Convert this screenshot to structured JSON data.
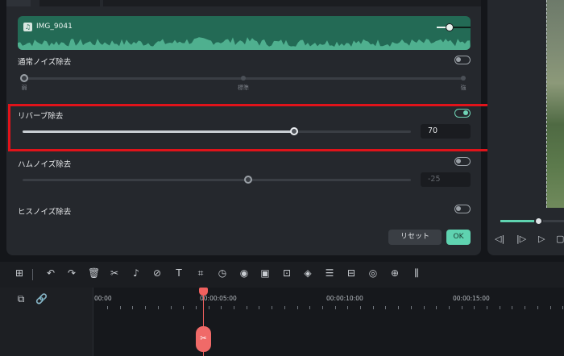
{
  "audio_clip": {
    "name": "IMG_9041",
    "icon": "music-note-icon",
    "volume_level": 0.3
  },
  "normal_denoise": {
    "label": "通常ノイズ除去",
    "enabled": false,
    "tick_labels": [
      "弱",
      "標準",
      "強"
    ],
    "level": 0
  },
  "reverb_removal": {
    "label": "リバーブ除去",
    "enabled": true,
    "value": "70",
    "level": 0.7
  },
  "hum_removal": {
    "label": "ハムノイズ除去",
    "enabled": false,
    "value": "-25",
    "level": 0.58
  },
  "hiss_removal": {
    "label": "ヒスノイズ除去",
    "enabled": false
  },
  "buttons": {
    "reset": "リセット",
    "ok": "OK"
  },
  "preview": {
    "progress": 0.6
  },
  "timeline": {
    "ruler": [
      "00:00",
      "00:00:05:00",
      "00:00:10:00",
      "00:00:15:00"
    ]
  },
  "colors": {
    "accent": "#5fd3b0",
    "highlight": "#e0131a",
    "clip": "#236a55",
    "playhead": "#f0605e"
  }
}
